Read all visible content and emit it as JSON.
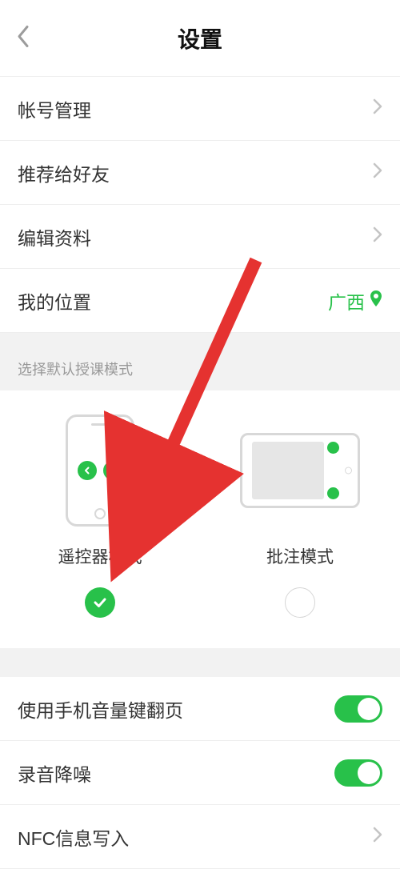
{
  "header": {
    "title": "设置"
  },
  "items": {
    "account": "帐号管理",
    "recommend": "推荐给好友",
    "editProfile": "编辑资料",
    "location": {
      "label": "我的位置",
      "value": "广西"
    }
  },
  "modeSection": {
    "heading": "选择默认授课模式",
    "remote": "遥控器模式",
    "annotate": "批注模式",
    "selected": "remote"
  },
  "toggles": {
    "volumeFlip": "使用手机音量键翻页",
    "noiseReduce": "录音降噪"
  },
  "nfc": "NFC信息写入"
}
